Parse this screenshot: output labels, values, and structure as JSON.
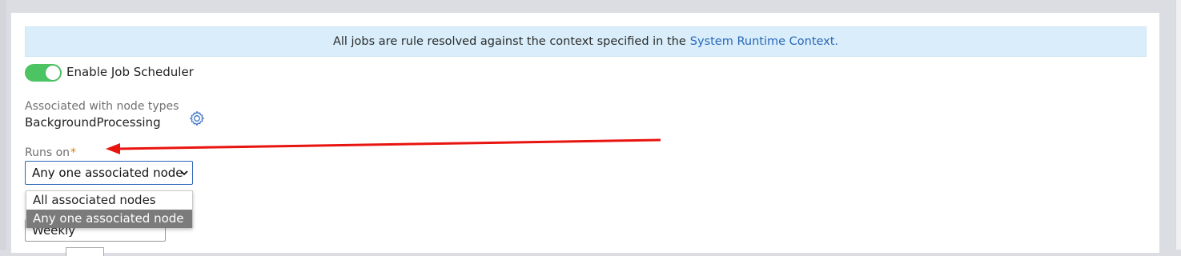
{
  "banner": {
    "text": "All jobs are rule resolved against the context specified in the",
    "link": "System Runtime Context."
  },
  "scheduler": {
    "toggle_label": "Enable Job Scheduler",
    "enabled": true
  },
  "node_types": {
    "label": "Associated with node types",
    "value": "BackgroundProcessing"
  },
  "runs_on": {
    "label": "Runs on",
    "required_mark": "*",
    "selected": "Any one associated node",
    "options": [
      "All associated nodes",
      "Any one associated node"
    ]
  },
  "schedule": {
    "value": "Weekly"
  },
  "colors": {
    "accent": "#2c63b8",
    "toggle_on": "#4cc463",
    "banner_bg": "#d9eefa",
    "annotation_arrow": "#e8140f"
  },
  "icons": {
    "node_types_settings": "gear-icon",
    "dropdown_caret": "chevron-down-icon"
  }
}
